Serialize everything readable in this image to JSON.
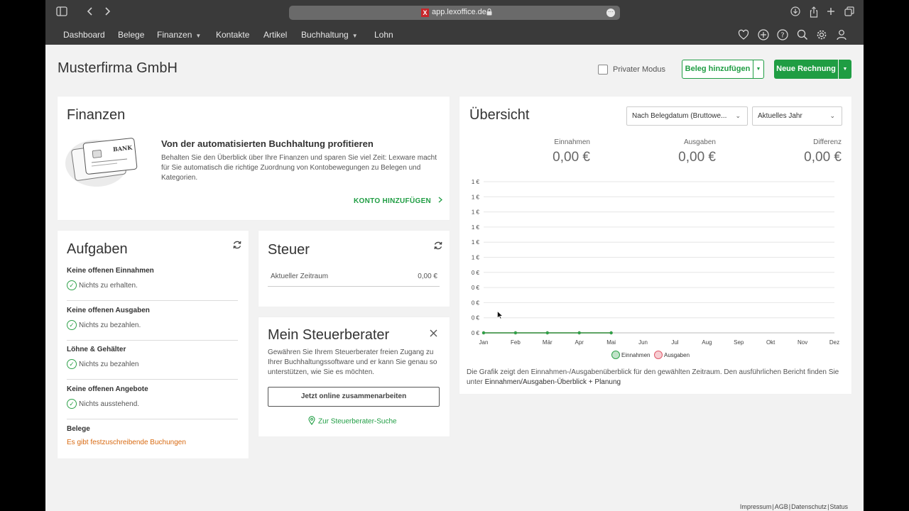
{
  "browser": {
    "url": "app.lexoffice.de",
    "favicon": "X"
  },
  "nav": {
    "items": [
      {
        "label": "Dashboard"
      },
      {
        "label": "Belege"
      },
      {
        "label": "Finanzen"
      },
      {
        "label": "Kontakte"
      },
      {
        "label": "Artikel"
      },
      {
        "label": "Buchhaltung"
      },
      {
        "label": "Lohn"
      }
    ],
    "icons": [
      "heart-icon",
      "plus-circle-icon",
      "help-icon",
      "search-icon",
      "gear-icon",
      "user-icon"
    ]
  },
  "header": {
    "company": "Musterfirma GmbH",
    "private_mode_label": "Privater Modus",
    "private_mode_checked": false,
    "add_receipt_label": "Beleg hinzufügen",
    "new_invoice_label": "Neue Rechnung"
  },
  "finanzen": {
    "title": "Finanzen",
    "card_image_label": "BANK",
    "heading": "Von der automatisierten Buchhaltung profitieren",
    "text": "Behalten Sie den Überblick über Ihre Finanzen und sparen Sie viel Zeit: Lexware macht für Sie automatisch die richtige Zuordnung von Kontobewegungen zu Belegen und Kategorien.",
    "link_label": "KONTO HINZUFÜGEN"
  },
  "aufgaben": {
    "title": "Aufgaben",
    "groups": [
      {
        "title": "Keine offenen Einnahmen",
        "status": "Nichts zu erhalten."
      },
      {
        "title": "Keine offenen Ausgaben",
        "status": "Nichts zu bezahlen."
      },
      {
        "title": "Löhne & Gehälter",
        "status": "Nichts zu bezahlen"
      },
      {
        "title": "Keine offenen Angebote",
        "status": "Nichts ausstehend."
      }
    ],
    "belege_title": "Belege",
    "belege_warning": "Es gibt festzuschreibende Buchungen"
  },
  "steuer": {
    "title": "Steuer",
    "period_label": "Aktueller Zeitraum",
    "period_value": "0,00 €"
  },
  "steuerberater": {
    "title": "Mein Steuerberater",
    "text": "Gewähren Sie Ihrem Steuerberater freien Zugang zu Ihrer Buchhaltungssoftware und er kann Sie genau so unterstützen, wie Sie es möchten.",
    "button_label": "Jetzt online zusammenarbeiten",
    "link_label": "Zur Steuerberater-Suche"
  },
  "uebersicht": {
    "title": "Übersicht",
    "filter_label": "Nach Belegdatum (Bruttowe...",
    "period_label": "Aktuelles Jahr",
    "stats": [
      {
        "label": "Einnahmen",
        "value": "0,00 €"
      },
      {
        "label": "Ausgaben",
        "value": "0,00 €"
      },
      {
        "label": "Differenz",
        "value": "0,00 €"
      }
    ],
    "note_text": "Die Grafik zeigt den Einnahmen-/Ausgabenüberblick für den gewählten Zeitraum. Den ausführlichen Bericht finden Sie unter",
    "note_link": "Einnahmen/Ausgaben-Überblick + Planung"
  },
  "chart_data": {
    "type": "line",
    "x": [
      "Jan",
      "Feb",
      "Mär",
      "Apr",
      "Mai",
      "Jun",
      "Jul",
      "Aug",
      "Sep",
      "Okt",
      "Nov",
      "Dez"
    ],
    "y_tick_labels": [
      "1 €",
      "1 €",
      "1 €",
      "1 €",
      "1 €",
      "1 €",
      "0 €",
      "0 €",
      "0 €",
      "0 €",
      "0 €"
    ],
    "ylim": [
      0,
      1
    ],
    "grid": true,
    "legend_position": "bottom",
    "series": [
      {
        "name": "Einnahmen",
        "color": "#2fa24a",
        "values": [
          0,
          0,
          0,
          0,
          0
        ]
      },
      {
        "name": "Ausgaben",
        "color": "#e05a6a",
        "values": [
          0,
          0,
          0,
          0,
          0
        ]
      }
    ]
  },
  "footer": {
    "links": [
      "Impressum",
      "AGB",
      "Datenschutz",
      "Status"
    ]
  }
}
